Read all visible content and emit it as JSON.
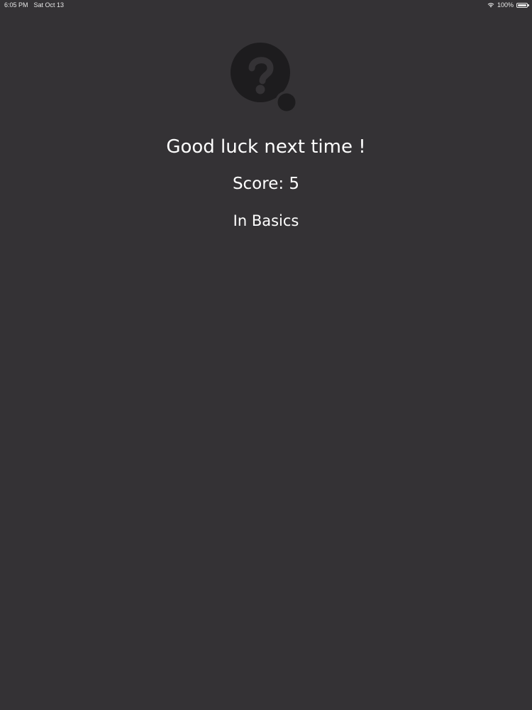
{
  "status_bar": {
    "time": "6:05 PM",
    "date": "Sat Oct 13",
    "battery_percent": "100%",
    "wifi_icon": "wifi-icon",
    "battery_icon": "battery-icon"
  },
  "result": {
    "icon": "question-mark-icon",
    "title": "Good luck next time !",
    "score": "Score: 5",
    "category": "In Basics"
  },
  "colors": {
    "background": "#343235",
    "icon": "#1d1c1e",
    "text": "#ffffff"
  }
}
